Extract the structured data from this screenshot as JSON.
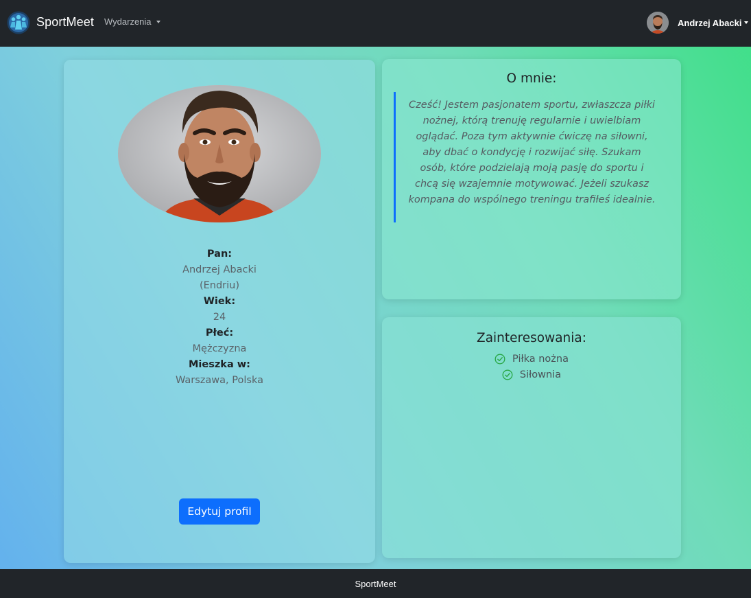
{
  "navbar": {
    "logo_icon": "people-group-logo-icon",
    "brand": "SportMeet",
    "events_menu": "Wydarzenia",
    "user_name": "Andrzej Abacki",
    "avatar_icon": "user-avatar-photo"
  },
  "profile": {
    "photo": "profile-photo-bearded-man",
    "title_label": "Pan:",
    "full_name": "Andrzej Abacki",
    "nickname": "(Endriu)",
    "age_label": "Wiek:",
    "age": "24",
    "gender_label": "Płeć:",
    "gender": "Mężczyzna",
    "city_label": "Mieszka w:",
    "city": "Warszawa, Polska",
    "edit_button": "Edytuj profil"
  },
  "about": {
    "title": "O mnie:",
    "text": "Cześć! Jestem pasjonatem sportu, zwłaszcza piłki nożnej, którą trenuję regularnie i uwielbiam oglądać. Poza tym aktywnie ćwiczę na siłowni, aby dbać o kondycję i rozwijać siłę. Szukam osób, które podzielają moją pasję do sportu i chcą się wzajemnie motywować. Jeżeli szukasz kompana do wspólnego treningu trafiłeś idealnie."
  },
  "interests": {
    "title": "Zainteresowania:",
    "items": [
      "Piłka nożna",
      "Siłownia"
    ],
    "check_color": "#28a745"
  },
  "footer": {
    "text": "SportMeet"
  },
  "colors": {
    "navbar_bg": "#212529",
    "primary": "#0d6efd"
  }
}
